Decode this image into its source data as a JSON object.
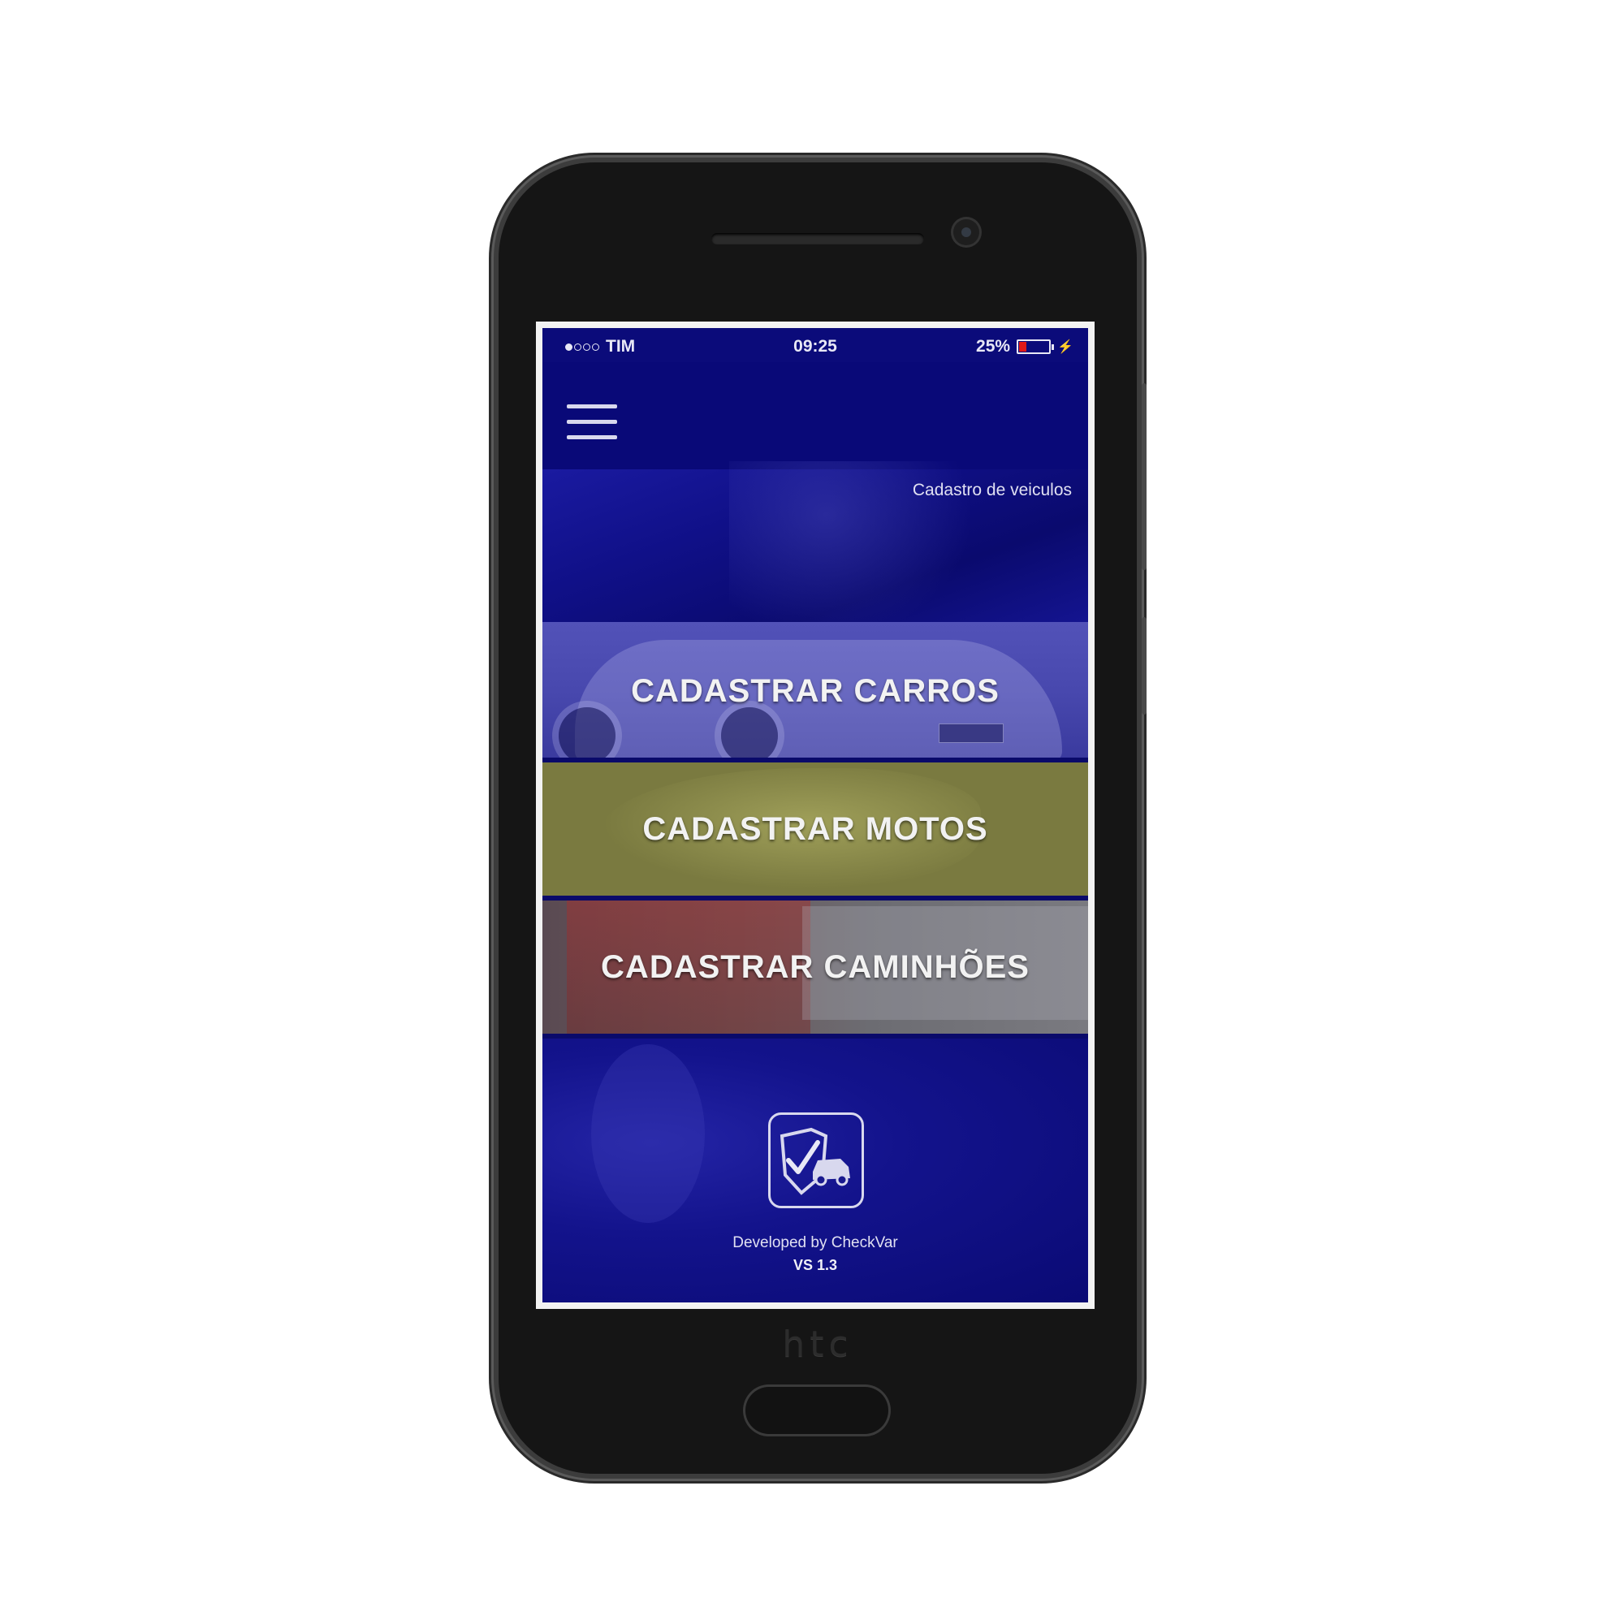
{
  "device": {
    "brand": "htc"
  },
  "status_bar": {
    "carrier": "TIM",
    "time": "09:25",
    "battery_percent": "25%",
    "battery_level": 0.25,
    "battery_color": "#e01818"
  },
  "header": {
    "menu_icon": "hamburger-menu-icon",
    "subtitle": "Cadastro de veiculos"
  },
  "options": [
    {
      "label": "CADASTRAR CARROS",
      "tint": "#4848ae"
    },
    {
      "label": "CADASTRAR MOTOS",
      "tint": "#7a7a40"
    },
    {
      "label": "CADASTRAR CAMINHÕES",
      "tint": "#6a6a70"
    }
  ],
  "footer": {
    "logo_icon": "shield-check-car-icon",
    "credit": "Developed by CheckVar",
    "version": "VS 1.3"
  },
  "colors": {
    "primary": "#0b0b7a",
    "appbar": "#090978"
  }
}
